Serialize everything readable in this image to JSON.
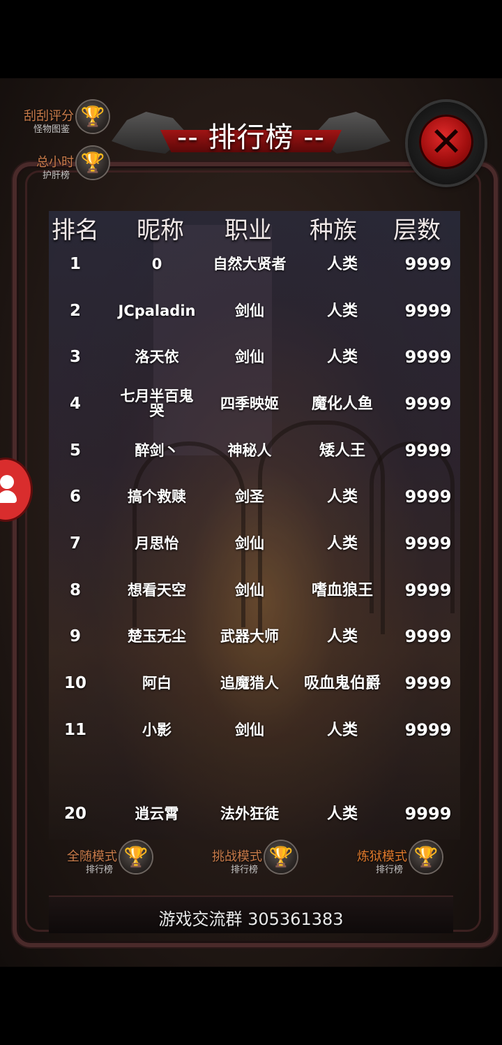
{
  "title": "-- 排行榜 --",
  "side_top": [
    {
      "main": "刮刮评分",
      "sub": "怪物图鉴",
      "icon": "trophy-icon"
    },
    {
      "main": "总小时",
      "sub": "护肝榜",
      "icon": "trophy-icon"
    }
  ],
  "table": {
    "headers": [
      "排名",
      "昵称",
      "职业",
      "种族",
      "层数"
    ],
    "rows": [
      {
        "rank": "1",
        "name": "0",
        "job": "自然大贤者",
        "race": "人类",
        "level": "9999"
      },
      {
        "rank": "2",
        "name": "JCpaladin",
        "job": "剑仙",
        "race": "人类",
        "level": "9999"
      },
      {
        "rank": "3",
        "name": "洛天依",
        "job": "剑仙",
        "race": "人类",
        "level": "9999"
      },
      {
        "rank": "4",
        "name": "七月半百鬼哭",
        "job": "四季映姬",
        "race": "魔化人鱼",
        "level": "9999"
      },
      {
        "rank": "5",
        "name": "醉剑丶",
        "job": "神秘人",
        "race": "矮人王",
        "level": "9999"
      },
      {
        "rank": "6",
        "name": "搞个救赎",
        "job": "剑圣",
        "race": "人类",
        "level": "9999"
      },
      {
        "rank": "7",
        "name": "月思怡",
        "job": "剑仙",
        "race": "人类",
        "level": "9999"
      },
      {
        "rank": "8",
        "name": "想看天空",
        "job": "剑仙",
        "race": "嗜血狼王",
        "level": "9999"
      },
      {
        "rank": "9",
        "name": "楚玉无尘",
        "job": "武器大师",
        "race": "人类",
        "level": "9999"
      },
      {
        "rank": "10",
        "name": "阿白",
        "job": "追魔猎人",
        "race": "吸血鬼伯爵",
        "level": "9999"
      },
      {
        "rank": "11",
        "name": "小影",
        "job": "剑仙",
        "race": "人类",
        "level": "9999"
      }
    ],
    "last_row": {
      "rank": "20",
      "name": "逍云霄",
      "job": "法外狂徒",
      "race": "人类",
      "level": "9999"
    }
  },
  "modes": [
    {
      "main": "全随模式",
      "sub": "排行榜",
      "icon": "trophy-icon"
    },
    {
      "main": "挑战模式",
      "sub": "排行榜",
      "icon": "trophy-icon"
    },
    {
      "main": "炼狱模式",
      "sub": "排行榜",
      "icon": "trophy-icon"
    }
  ],
  "group_text": "游戏交流群 305361383",
  "colors": {
    "accent_orange": "#c87b4a",
    "close_red": "#d02020",
    "frame": "#4a2a2a"
  }
}
